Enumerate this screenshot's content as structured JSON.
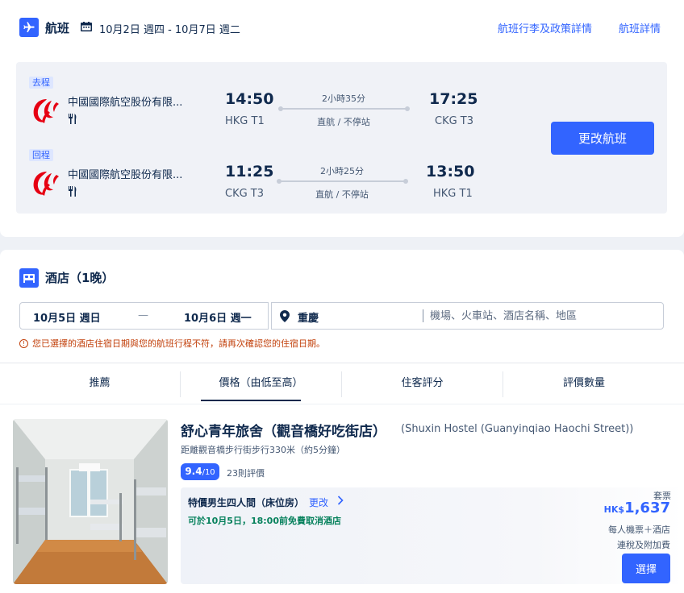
{
  "flight": {
    "title": "航班",
    "dates": "10月2日 週四 - 10月7日 週二",
    "baggage_link": "航班行李及政策詳情",
    "details_link": "航班詳情",
    "outbound": {
      "tag": "去程",
      "airline": "中國國際航空股份有限...",
      "dep_time": "14:50",
      "dep_airport": "HKG T1",
      "duration": "2小時35分",
      "stops": "直航 / 不停站",
      "arr_time": "17:25",
      "arr_airport": "CKG T3"
    },
    "return": {
      "tag": "回程",
      "airline": "中國國際航空股份有限...",
      "dep_time": "11:25",
      "dep_airport": "CKG T3",
      "duration": "2小時25分",
      "stops": "直航 / 不停站",
      "arr_time": "13:50",
      "arr_airport": "HKG T1"
    },
    "change_button": "更改航班",
    "brand_color": "#3264ff",
    "airline_logo_color": "#e60012"
  },
  "hotel": {
    "title": "酒店（1晚）",
    "checkin": "10月5日 週日",
    "date_separator": "—",
    "checkout": "10月6日 週一",
    "destination": "重慶",
    "search_placeholder": "機場、火車站、酒店名稱、地區",
    "warning": "您已選擇的酒店住宿日期與您的航班行程不符，請再次確認您的住宿日期。",
    "sort_tabs": [
      "推薦",
      "價格（由低至高）",
      "住客評分",
      "評價數量"
    ],
    "active_sort": "價格（由低至高）",
    "result": {
      "name": "舒心青年旅舍（觀音橋好吃街店）",
      "name_en": "(Shuxin Hostel (Guanyinqiao Haochi Street))",
      "distance": "距離觀音橋步行街步行330米（約5分鐘）",
      "score": "9.4",
      "score_max": "/10",
      "reviews": "23則評價",
      "room": "特價男生四人間（床位房）",
      "room_change": "更改",
      "cancel_note": "可於10月5日，18:00前免費取消酒店",
      "package_label": "套票",
      "price_currency": "HK$",
      "price_amount": "1,637",
      "per_person": "每人機票＋酒店",
      "tax_note": "連稅及附加費",
      "select_button": "選擇"
    }
  },
  "icons": [
    "airplane-icon",
    "calendar-icon",
    "airline-logo",
    "meal-icon",
    "bed-icon",
    "location-pin-icon",
    "warning-icon",
    "chevron-right-icon"
  ]
}
